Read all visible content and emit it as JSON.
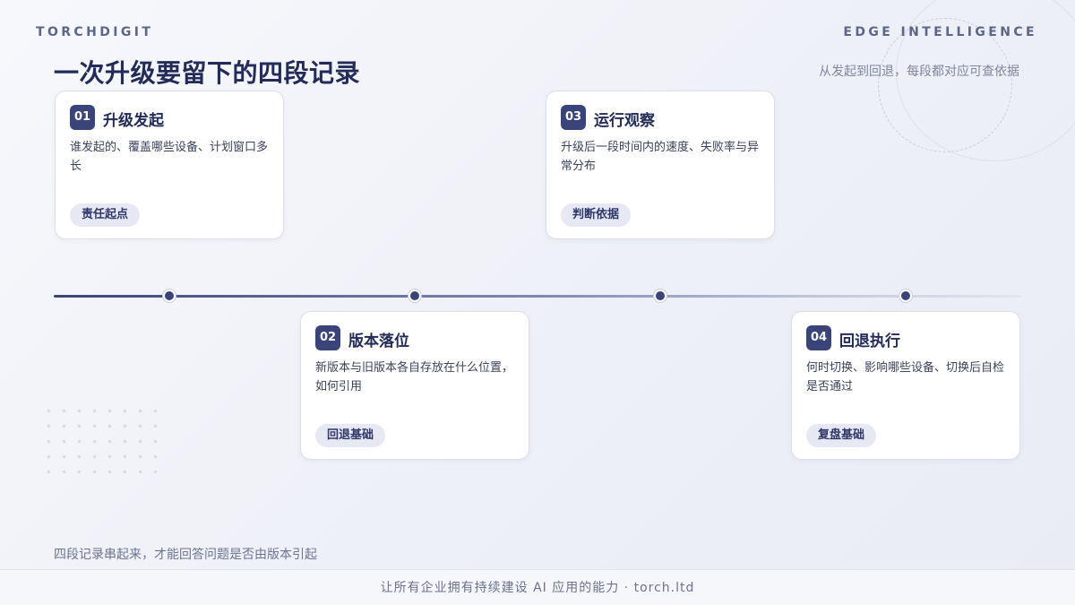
{
  "header": {
    "brand": "TORCHDIGIT",
    "edge_label": "EDGE INTELLIGENCE",
    "title": "一次升级要留下的四段记录",
    "subtitle": "从发起到回退，每段都对应可查依据"
  },
  "cards": [
    {
      "num": "01",
      "title": "升级发起",
      "desc": "谁发起的、覆盖哪些设备、计划窗口多长",
      "tag": "责任起点"
    },
    {
      "num": "02",
      "title": "版本落位",
      "desc": "新版本与旧版本各自存放在什么位置，如何引用",
      "tag": "回退基础"
    },
    {
      "num": "03",
      "title": "运行观察",
      "desc": "升级后一段时间内的速度、失败率与异常分布",
      "tag": "判断依据"
    },
    {
      "num": "04",
      "title": "回退执行",
      "desc": "何时切换、影响哪些设备、切换后自检是否通过",
      "tag": "复盘基础"
    }
  ],
  "conclusion": "四段记录串起来，才能回答问题是否由版本引起",
  "footer": "让所有企业拥有持续建设 AI 应用的能力 · torch.ltd",
  "colors": {
    "accent": "#3a4479",
    "background": "#eef0f7",
    "tag_bg": "#e6e8f4"
  }
}
